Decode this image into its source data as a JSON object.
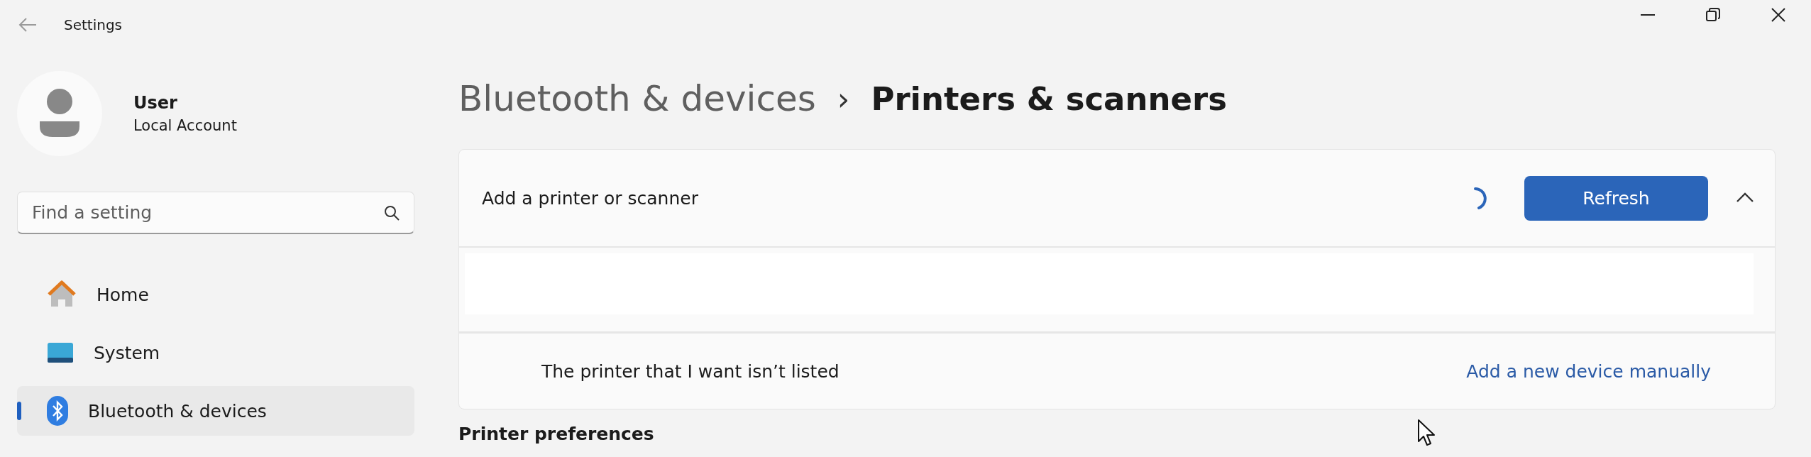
{
  "window": {
    "title": "Settings"
  },
  "account": {
    "name": "User",
    "type": "Local Account"
  },
  "search": {
    "placeholder": "Find a setting"
  },
  "sidebar": {
    "items": [
      {
        "label": "Home",
        "kind": "home",
        "selected": false
      },
      {
        "label": "System",
        "kind": "system",
        "selected": false
      },
      {
        "label": "Bluetooth & devices",
        "kind": "bluetooth",
        "selected": true
      }
    ]
  },
  "breadcrumb": {
    "parent": "Bluetooth & devices",
    "separator": "›",
    "current": "Printers & scanners"
  },
  "add_card": {
    "title": "Add a printer or scanner",
    "loading": true,
    "button": "Refresh",
    "expanded": true,
    "missing_text": "The printer that I want isn’t listed",
    "link": "Add a new device manually"
  },
  "section": {
    "heading": "Printer preferences"
  }
}
